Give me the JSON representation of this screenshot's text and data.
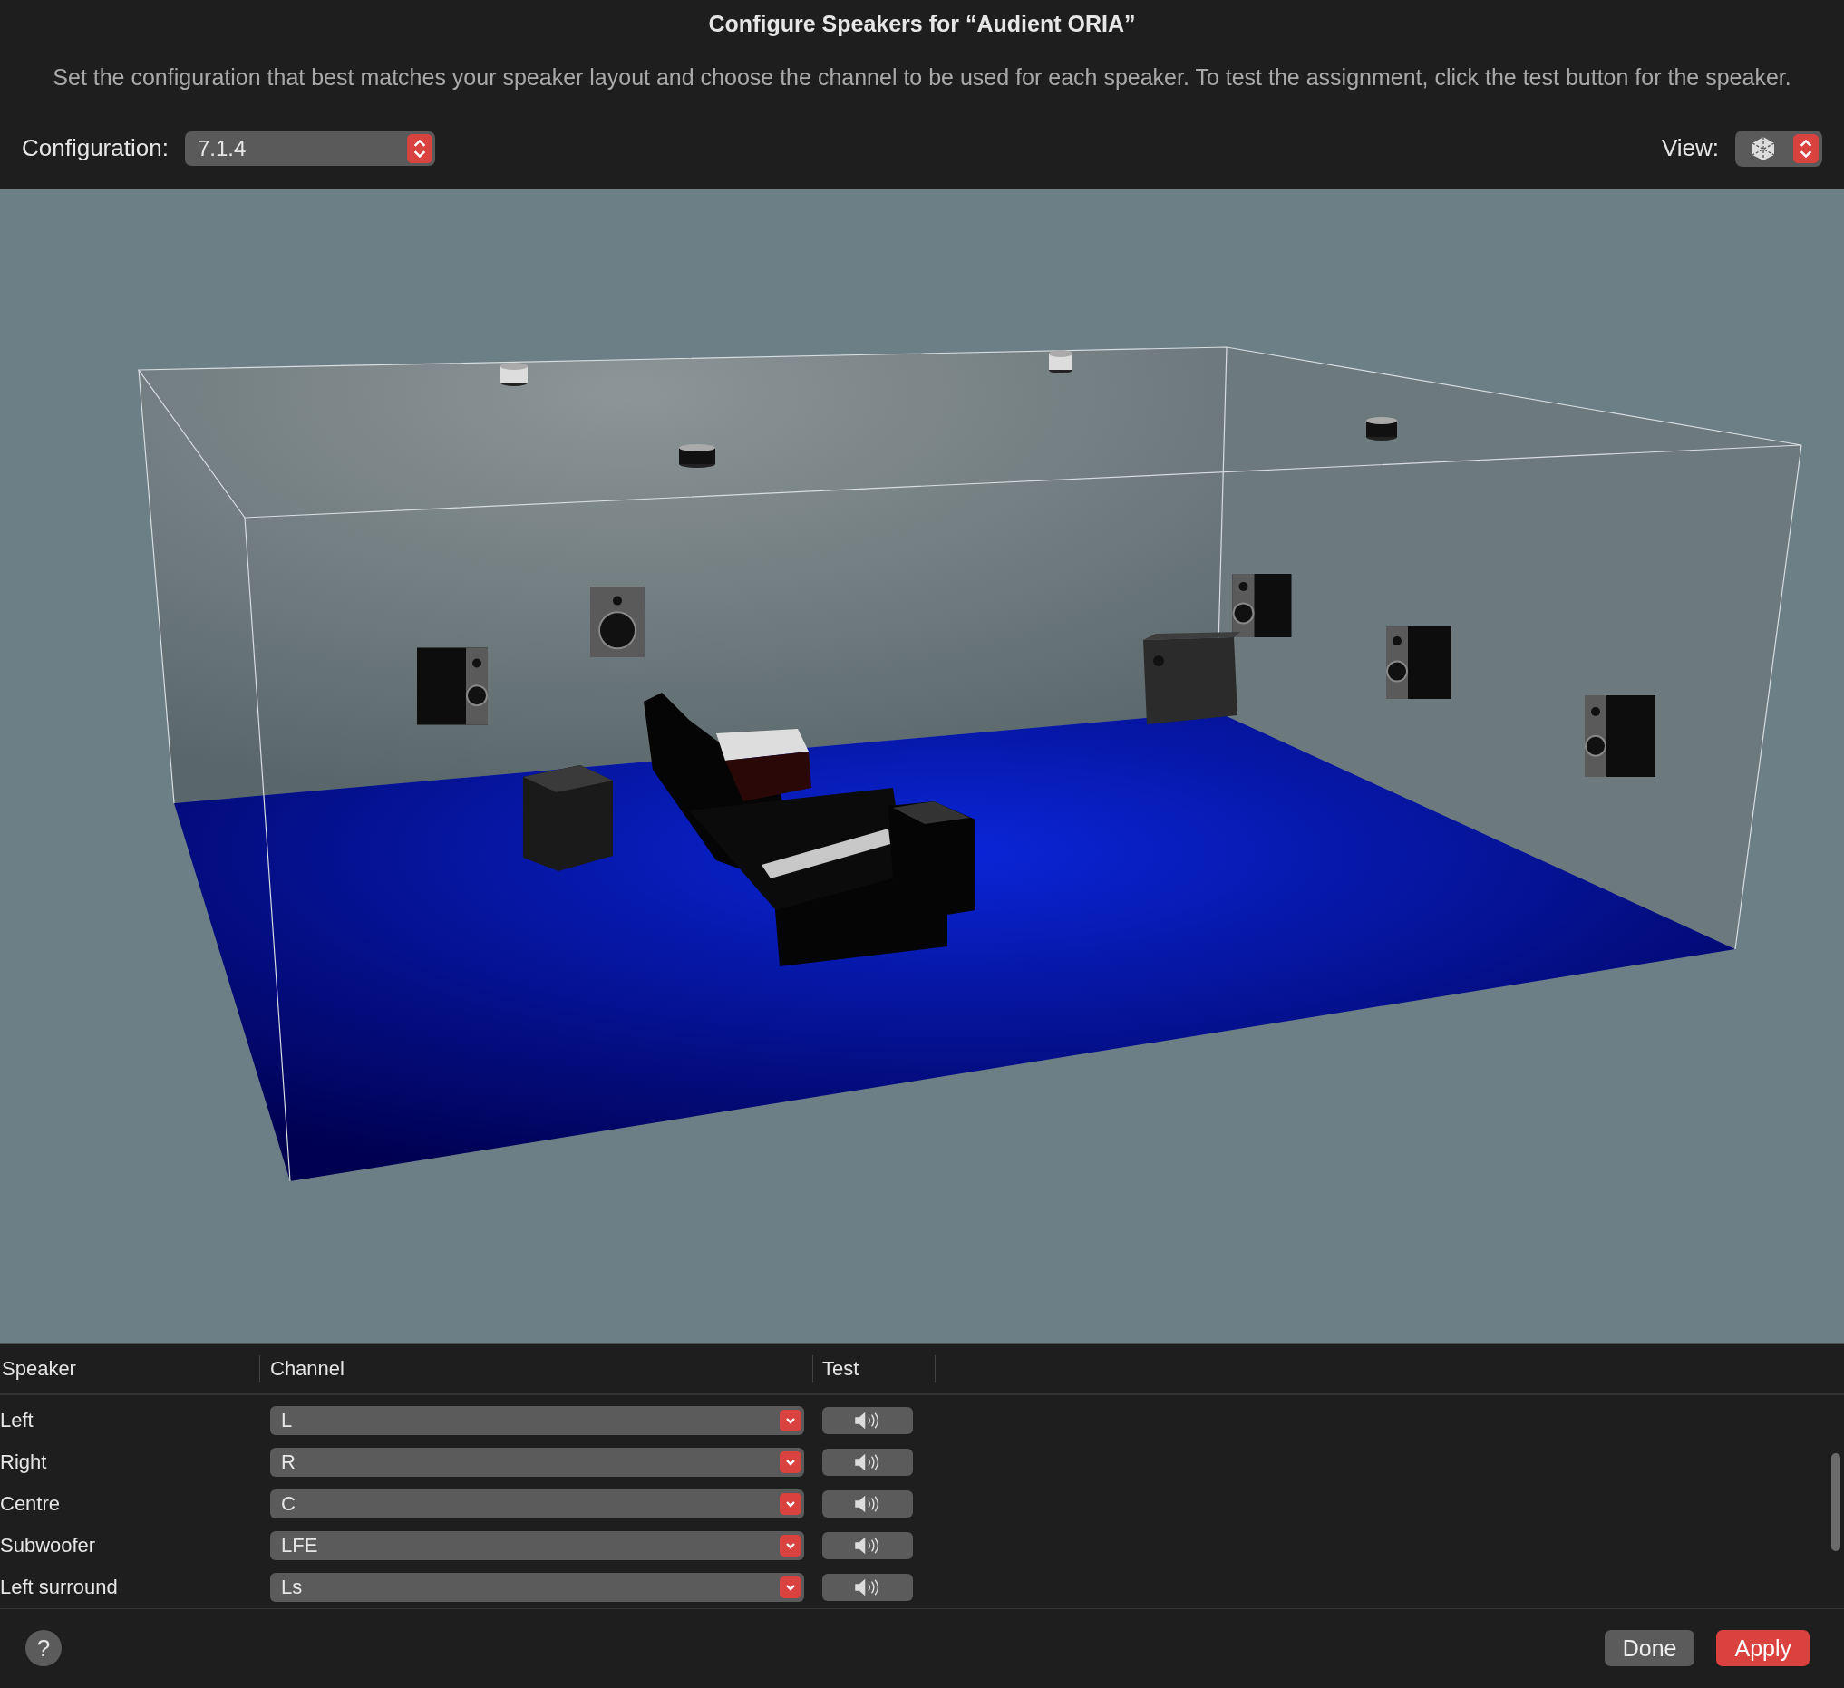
{
  "dialog": {
    "title": "Configure Speakers for “Audient ORIA”",
    "description": "Set the configuration that best matches your speaker layout and choose the channel to be used for each speaker. To test the assignment, click the test button for the speaker."
  },
  "configuration": {
    "label": "Configuration:",
    "value": "7.1.4"
  },
  "view": {
    "label": "View:"
  },
  "table": {
    "columns": [
      "Speaker",
      "Channel",
      "Test"
    ],
    "rows": [
      {
        "speaker": "Left",
        "channel": "L"
      },
      {
        "speaker": "Right",
        "channel": "R"
      },
      {
        "speaker": "Centre",
        "channel": "C"
      },
      {
        "speaker": "Subwoofer",
        "channel": "LFE"
      },
      {
        "speaker": "Left surround",
        "channel": "Ls"
      }
    ]
  },
  "help": {
    "label": "?"
  },
  "buttons": [
    {
      "label": "Done",
      "default": false
    },
    {
      "label": "Apply",
      "default": true
    }
  ]
}
